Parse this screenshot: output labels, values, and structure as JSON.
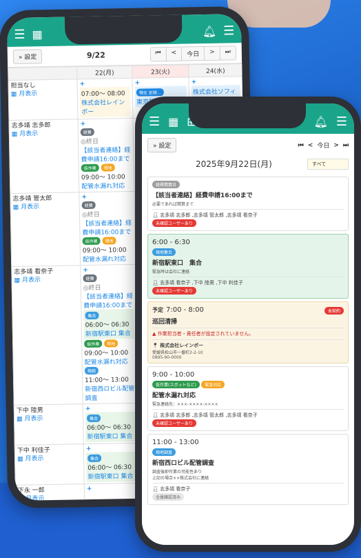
{
  "back": {
    "colors": {
      "accent": "#1aa58b",
      "bg": "#1e6fd6"
    }
  },
  "phone1": {
    "settings": "» 設定",
    "date": "9/22",
    "today": "今日",
    "nav_first": "⏮",
    "nav_prev": "<",
    "nav_next": ">",
    "nav_last": "⏭",
    "cols": [
      "22(月)",
      "23(火)",
      "24(水)"
    ],
    "month_link": "月表示",
    "rows": [
      {
        "name": "担当なし",
        "c1": [
          "07:00〜 08:00",
          "株式会社レインボー"
        ],
        "c2_chip": "現在 定期…",
        "c2": "東京駅",
        "c3": "株式会社ソフィア"
      },
      {
        "name": "志多靖 志多郎",
        "chip1": "経費",
        "end": "◎終日",
        "task": "【該当者連絡】経費申請16:00まで",
        "chip2": "仮作業",
        "chip3": "現地",
        "t2": "09:00〜 10:00",
        "t2b": "配管水漏れ対応"
      },
      {
        "name": "志多靖 管太郎",
        "chip1": "経費",
        "end": "◎終日",
        "task": "【該当者連絡】経費申請16:00まで",
        "chip2": "仮作業",
        "chip3": "現地",
        "t2": "09:00〜 10:00",
        "t2b": "配管水漏れ対応"
      },
      {
        "name": "志多靖 看奈子",
        "chip1": "経費",
        "end": "◎終日",
        "task": "【該当者連絡】経費申請16:00まで",
        "chipg": "集合",
        "t1": "06:00〜 06:30",
        "t1b": "新宿駅東口 集合",
        "chip2": "仮作業",
        "chip3": "現地",
        "t2": "09:00〜 10:00",
        "t2b": "配管水漏れ対応",
        "chip4": "現調",
        "t3": "11:00〜 13:00",
        "t3b": "新宿西ロビル配管調査"
      },
      {
        "name": "下中 陸男",
        "chipg": "集合",
        "t1": "06:00〜 06:30",
        "t1b": "新宿駅東口 集合"
      },
      {
        "name": "下中 利佳子",
        "chipg": "集合",
        "t1": "06:00〜 06:30",
        "t1b": "新宿駅東口 集合"
      },
      {
        "name": "下永 一郎"
      }
    ]
  },
  "phone2": {
    "settings": "» 設定",
    "today": "今日",
    "date_title": "2025年9月22日(月)",
    "filter": "すべて",
    "cards": [
      {
        "chip": "経費精算日",
        "title": "【該当者連絡】経費申請16:00まで",
        "sub": "必要であれば精算まで",
        "who": "志多靖 志多郎 ,志多靖 管太郎 ,志多靖 看奈子",
        "badge": "未確認ユーザーあり"
      },
      {
        "time": "6:00 - 6:30",
        "chip": "現地集合",
        "title": "新宿駅東口　集合",
        "sub": "緊急時は会社に連絡",
        "who": "志多靖 看奈子 ,下中 陸男 ,下中 利佳子",
        "badge": "未確認ユーザーあり"
      },
      {
        "time_prefix": "予定",
        "time": "7:00 - 8:00",
        "flag": "本契約",
        "title": "巡回清掃",
        "warn": "作業担当者・責任者が設定されていません。",
        "company": "株式会社レインボー",
        "addr": "愛媛県松山市一番町2-2-10",
        "tel": "0895-90-0000"
      },
      {
        "time": "9:00 - 10:00",
        "chip": "仮作業(スポットなど)",
        "chip2": "緊急対応",
        "title": "配管水漏れ対応",
        "sub": "緊急連絡先：×××-××××-××××",
        "who": "志多靖 志多郎 ,志多靖 管太郎 ,志多靖 看奈子",
        "badge": "未確認ユーザーあり"
      },
      {
        "time": "11:00 - 13:00",
        "chip": "現地調査",
        "title": "新宿西ロビル配管調査",
        "sub": "調査後即作業の可能性あり",
        "sub2": "上記の場合××株式会社に連絡",
        "who": "志多靖 看奈子",
        "badge": "全員確認済み"
      }
    ]
  }
}
